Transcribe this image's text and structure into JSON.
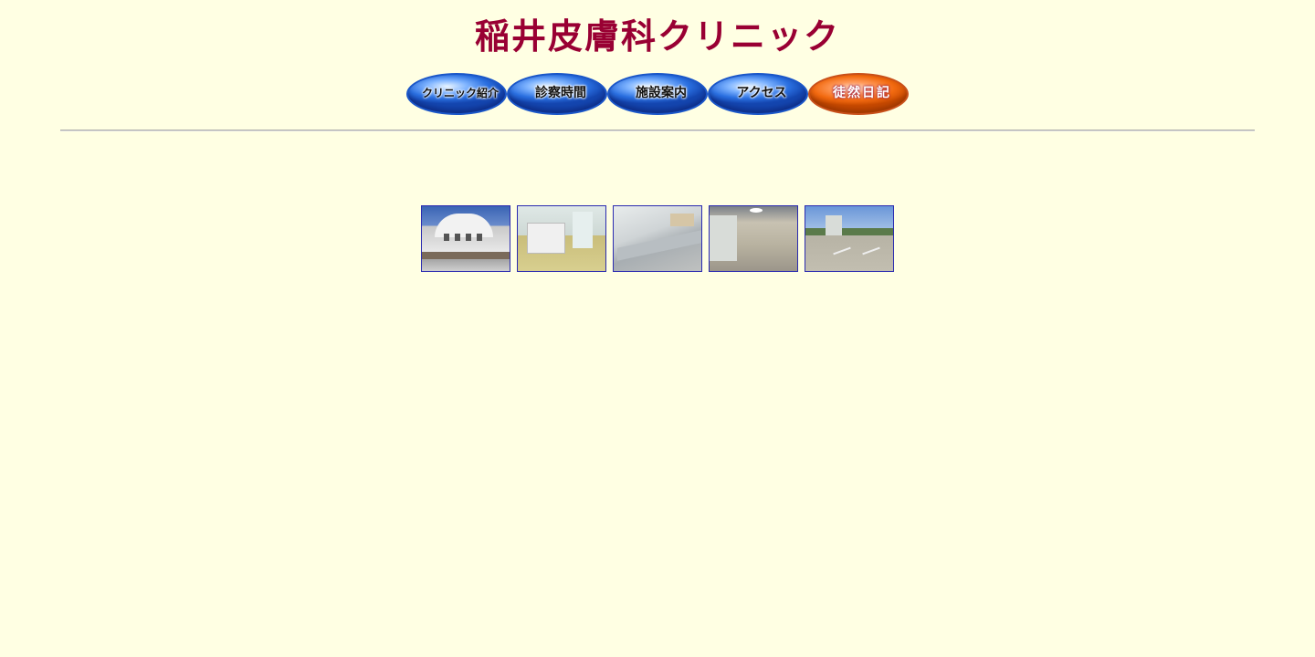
{
  "header": {
    "title": "稲井皮膚科クリニック"
  },
  "nav": {
    "items": [
      {
        "label": "クリニック紹介",
        "active": false
      },
      {
        "label": "診察時間",
        "active": false
      },
      {
        "label": "施設案内",
        "active": false
      },
      {
        "label": "アクセス",
        "active": false
      },
      {
        "label": "徒然日記",
        "active": true
      }
    ],
    "colors": {
      "button": "#2a6fe0",
      "active_button": "#f26a10"
    }
  },
  "gallery": {
    "photos": [
      {
        "subject": "building-exterior"
      },
      {
        "subject": "reception"
      },
      {
        "subject": "waiting-bench"
      },
      {
        "subject": "corridor"
      },
      {
        "subject": "parking-lot"
      }
    ]
  },
  "theme": {
    "background": "#FFFFE3",
    "title_color": "#990033"
  }
}
